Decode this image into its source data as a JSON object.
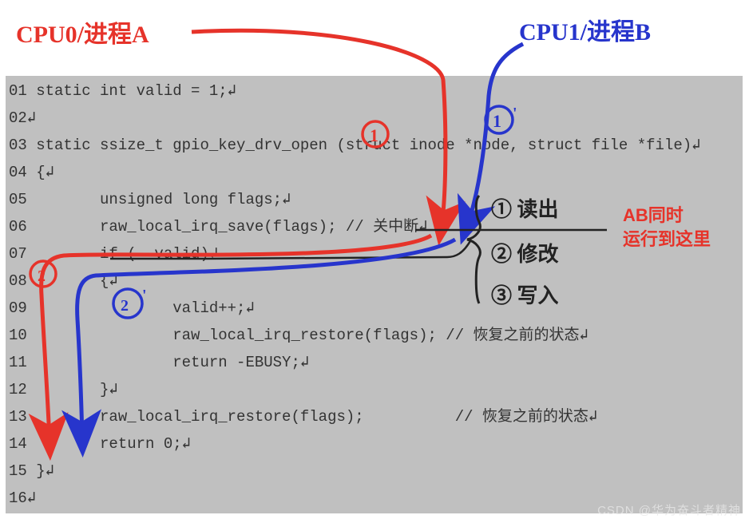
{
  "labels": {
    "cpu0": "CPU0/进程A",
    "cpu1": "CPU1/进程B",
    "step1_red": "①",
    "step1b_blue": "①'",
    "step2_red": "②",
    "step2b_blue": "②'",
    "side_note_1": "① 读出",
    "side_note_2": "② 修改",
    "side_note_3": "③ 写入",
    "ab_note_line1": "AB同时",
    "ab_note_line2": "运行到这里"
  },
  "code": {
    "l1": "01 static int valid = 1;↲",
    "l2": "02↲",
    "l3": "03 static ssize_t gpio_key_drv_open (struct inode *node, struct file *file)↲",
    "l4": "04 {↲",
    "l5": "05        unsigned long flags;↲",
    "l6": "06        raw_local_irq_save(flags); // 关中断↲",
    "l7": "07        if (--valid)↲",
    "l8": "08        {↲",
    "l9": "09                valid++;↲",
    "l10": "10                raw_local_irq_restore(flags); // 恢复之前的状态↲",
    "l11": "11                return -EBUSY;↲",
    "l12": "12        }↲",
    "l13": "13        raw_local_irq_restore(flags);          // 恢复之前的状态↲",
    "l14": "14        return 0;↲",
    "l15": "15 }↲",
    "l16": "16↲"
  },
  "watermark": "CSDN @华为奋斗者精神"
}
